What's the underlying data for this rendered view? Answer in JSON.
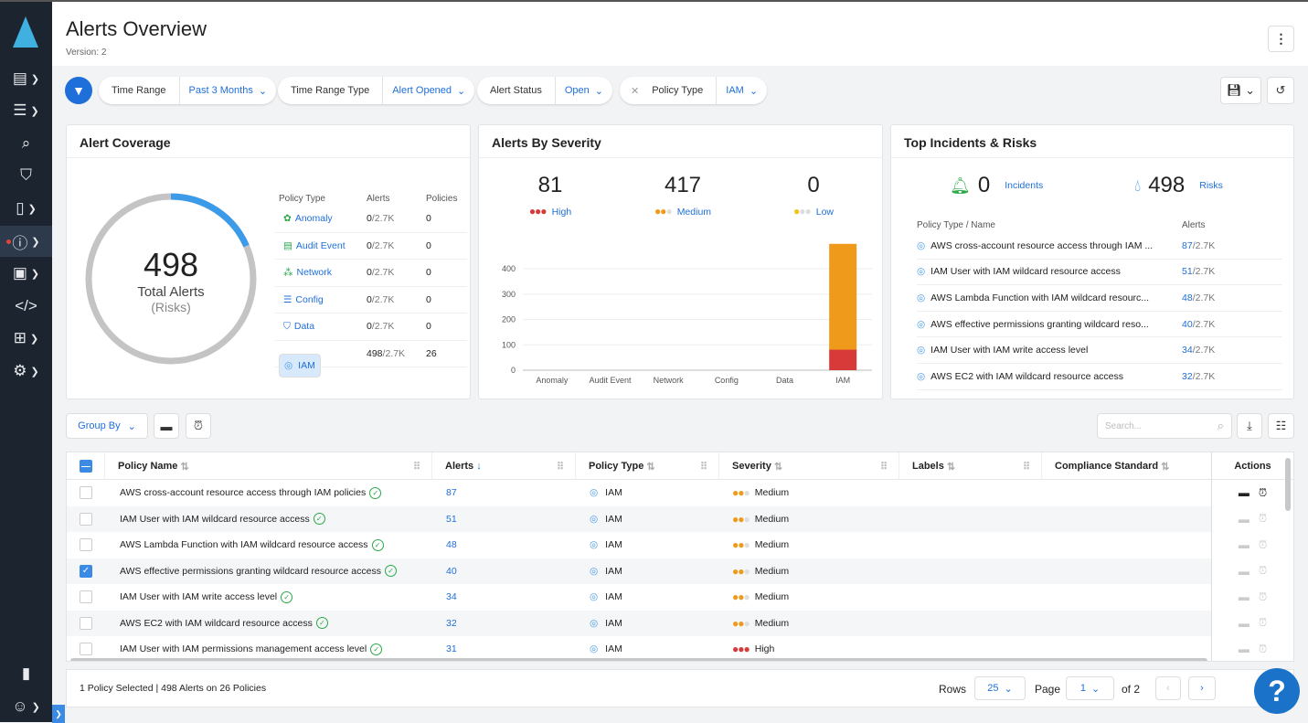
{
  "header": {
    "title": "Alerts Overview",
    "version": "Version: 2"
  },
  "filters": [
    {
      "key": "Time Range",
      "value": "Past 3 Months"
    },
    {
      "key": "Time Range Type",
      "value": "Alert Opened"
    },
    {
      "key": "Alert Status",
      "value": "Open"
    },
    {
      "key": "Policy Type",
      "value": "IAM",
      "removable": true
    }
  ],
  "coverage": {
    "title": "Alert Coverage",
    "total": "498",
    "total_label": "Total Alerts",
    "sub_label": "(Risks)",
    "alerts": 498,
    "max_alerts": 2700,
    "headers": [
      "Policy Type",
      "Alerts",
      "Policies"
    ],
    "rows": [
      {
        "type": "Anomaly",
        "icon": "anomaly-icon",
        "alerts": "0",
        "of": "/2.7K",
        "policies": "0",
        "color": "#2aa84a"
      },
      {
        "type": "Audit Event",
        "icon": "audit-event-icon",
        "alerts": "0",
        "of": "/2.7K",
        "policies": "0",
        "color": "#2aa84a"
      },
      {
        "type": "Network",
        "icon": "network-icon",
        "alerts": "0",
        "of": "/2.7K",
        "policies": "0",
        "color": "#2aa84a"
      },
      {
        "type": "Config",
        "icon": "config-icon",
        "alerts": "0",
        "of": "/2.7K",
        "policies": "0",
        "color": "#1e6fd9"
      },
      {
        "type": "Data",
        "icon": "data-shield-icon",
        "alerts": "0",
        "of": "/2.7K",
        "policies": "0",
        "color": "#1e6fd9"
      },
      {
        "type": "IAM",
        "icon": "fingerprint-icon",
        "alerts": "498",
        "of": "/2.7K",
        "policies": "26",
        "color": "#4a9be8",
        "selected": true
      }
    ]
  },
  "severity": {
    "title": "Alerts By Severity",
    "summary": [
      {
        "count": "81",
        "label": "High",
        "color": "#d83a3a"
      },
      {
        "count": "417",
        "label": "Medium",
        "color": "#ef9a1a"
      },
      {
        "count": "0",
        "label": "Low",
        "color": "#f0c419"
      }
    ]
  },
  "chart_data": {
    "type": "bar",
    "stacked": true,
    "categories": [
      "Anomaly",
      "Audit Event",
      "Network",
      "Config",
      "Data",
      "IAM"
    ],
    "series": [
      {
        "name": "High",
        "color": "#d83a3a",
        "values": [
          0,
          0,
          0,
          0,
          0,
          81
        ]
      },
      {
        "name": "Medium",
        "color": "#ef9a1a",
        "values": [
          0,
          0,
          0,
          0,
          0,
          417
        ]
      }
    ],
    "yticks": [
      "0",
      "100",
      "200",
      "300",
      "400"
    ],
    "ylim": [
      0,
      500
    ],
    "grid": true
  },
  "incidents": {
    "title": "Top Incidents & Risks",
    "incidents_count": "0",
    "incidents_label": "Incidents",
    "risks_count": "498",
    "risks_label": "Risks",
    "headers": [
      "Policy Type / Name",
      "Alerts"
    ],
    "rows": [
      {
        "name": "AWS cross-account resource access through IAM ...",
        "alerts": "87",
        "of": "/2.7K"
      },
      {
        "name": "IAM User with IAM wildcard resource access",
        "alerts": "51",
        "of": "/2.7K"
      },
      {
        "name": "AWS Lambda Function with IAM wildcard resourc...",
        "alerts": "48",
        "of": "/2.7K"
      },
      {
        "name": "AWS effective permissions granting wildcard reso...",
        "alerts": "40",
        "of": "/2.7K"
      },
      {
        "name": "IAM User with IAM write access level",
        "alerts": "34",
        "of": "/2.7K"
      },
      {
        "name": "AWS EC2 with IAM wildcard resource access",
        "alerts": "32",
        "of": "/2.7K"
      }
    ]
  },
  "toolbar": {
    "group_by": "Group By",
    "search_placeholder": "Search..."
  },
  "table": {
    "columns": [
      "Policy Name",
      "Alerts",
      "Policy Type",
      "Severity",
      "Labels",
      "Compliance Standard",
      "Actions"
    ],
    "rows": [
      {
        "name": "AWS cross-account resource access through IAM policies",
        "alerts": "87",
        "type": "IAM",
        "severity": "Medium",
        "checked": false
      },
      {
        "name": "IAM User with IAM wildcard resource access",
        "alerts": "51",
        "type": "IAM",
        "severity": "Medium",
        "checked": false
      },
      {
        "name": "AWS Lambda Function with IAM wildcard resource access",
        "alerts": "48",
        "type": "IAM",
        "severity": "Medium",
        "checked": false
      },
      {
        "name": "AWS effective permissions granting wildcard resource access",
        "alerts": "40",
        "type": "IAM",
        "severity": "Medium",
        "checked": true
      },
      {
        "name": "IAM User with IAM write access level",
        "alerts": "34",
        "type": "IAM",
        "severity": "Medium",
        "checked": false
      },
      {
        "name": "AWS EC2 with IAM wildcard resource access",
        "alerts": "32",
        "type": "IAM",
        "severity": "Medium",
        "checked": false
      },
      {
        "name": "IAM User with IAM permissions management access level",
        "alerts": "31",
        "type": "IAM",
        "severity": "High",
        "checked": false
      }
    ]
  },
  "footer": {
    "summary": "1 Policy Selected | 498 Alerts on 26 Policies",
    "rows_label": "Rows",
    "rows_value": "25",
    "page_label": "Page",
    "page_value": "1",
    "of_pages": "of 2"
  },
  "help": "?"
}
